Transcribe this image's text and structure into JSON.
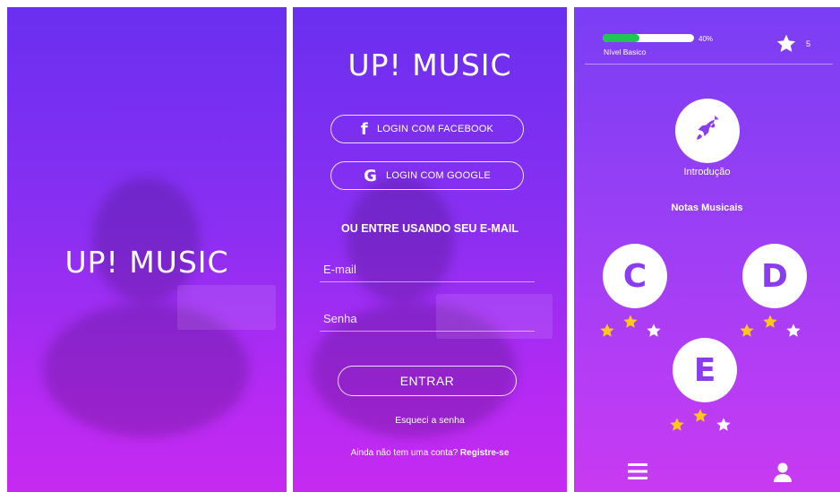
{
  "splash": {
    "logo": "UP! MUSIC"
  },
  "login": {
    "logo": "UP! MUSIC",
    "facebook_label": "LOGIN COM FACEBOOK",
    "google_label": "LOGIN COM GOOGLE",
    "or_text": "OU ENTRE USANDO SEU E-MAIL",
    "email_placeholder": "E-mail",
    "password_placeholder": "Senha",
    "enter_label": "ENTRAR",
    "forgot_label": "Esqueci a senha",
    "no_account_text": "Ainda não tem uma conta?",
    "signup_label": "Registre-se"
  },
  "home": {
    "progress_pct_label": "40%",
    "progress_value": 0.4,
    "level_label": "Nível Basico",
    "star_count": "5",
    "intro_label": "Introdução",
    "section_title": "Notas Musicais",
    "notes": [
      {
        "letter": "C",
        "stars_earned": 2,
        "stars_total": 3
      },
      {
        "letter": "D",
        "stars_earned": 2,
        "stars_total": 3
      },
      {
        "letter": "E",
        "stars_earned": 2,
        "stars_total": 3
      }
    ],
    "colors": {
      "progress": "#23c552",
      "star_earned": "#ffc81a",
      "star_empty": "#ffffff",
      "accent": "#8a3cf0"
    }
  }
}
